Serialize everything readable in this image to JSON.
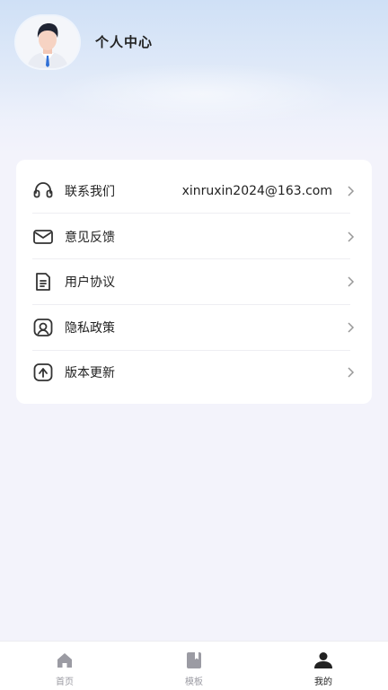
{
  "page": {
    "title": "个人中心"
  },
  "menu": [
    {
      "id": "contact",
      "label": "联系我们",
      "value": "xinruxin2024@163.com",
      "icon": "headset-icon"
    },
    {
      "id": "feedback",
      "label": "意见反馈",
      "icon": "mail-icon"
    },
    {
      "id": "agreement",
      "label": "用户协议",
      "icon": "document-icon"
    },
    {
      "id": "privacy",
      "label": "隐私政策",
      "icon": "privacy-user-icon"
    },
    {
      "id": "update",
      "label": "版本更新",
      "icon": "upgrade-icon"
    }
  ],
  "tabbar": [
    {
      "label": "首页",
      "icon": "home-icon",
      "active": false
    },
    {
      "label": "模板",
      "icon": "template-book-icon",
      "active": false
    },
    {
      "label": "我的",
      "icon": "person-icon",
      "active": true
    }
  ],
  "colors": {
    "background": "#f3f3fb",
    "card": "#ffffff",
    "text": "#222222",
    "inactive_tab": "#9b9ba3"
  }
}
